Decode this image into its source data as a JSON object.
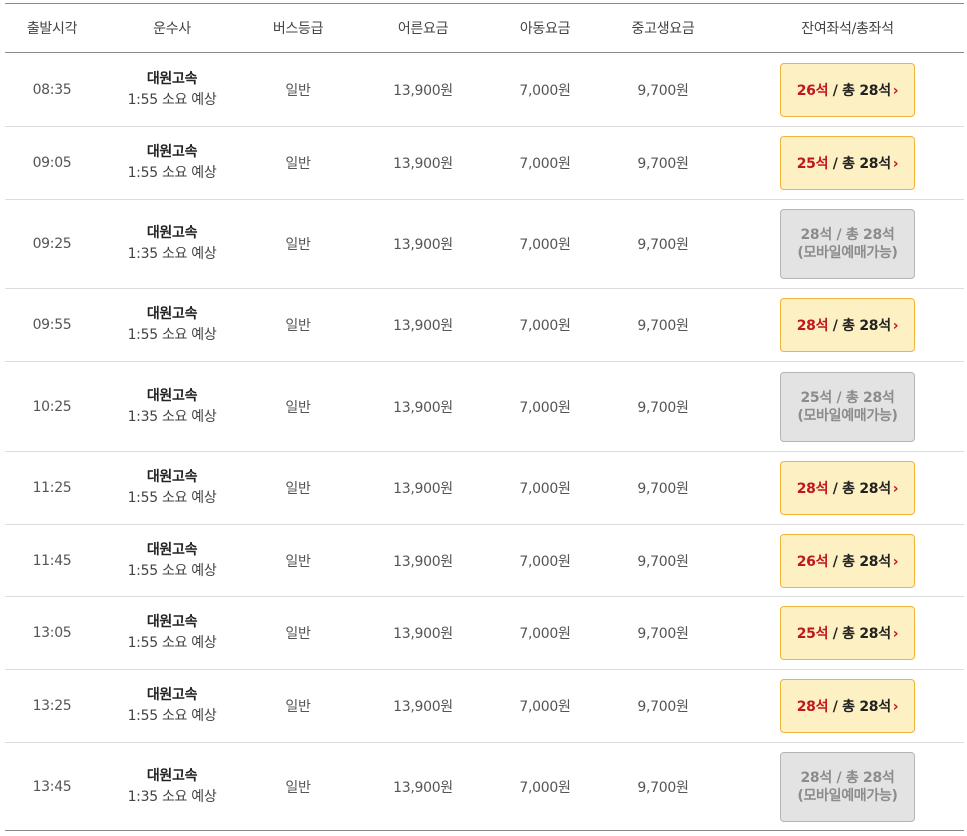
{
  "header": {
    "departure_time": "출발시각",
    "company": "운수사",
    "bus_grade": "버스등급",
    "adult_fare": "어른요금",
    "child_fare": "아동요금",
    "student_fare": "중고생요금",
    "seats": "잔여좌석/총좌석"
  },
  "rows": [
    {
      "time": "08:35",
      "company": "대원고속",
      "duration": "1:55 소요 예상",
      "grade": "일반",
      "adult": "13,900원",
      "child": "7,000원",
      "student": "9,700원",
      "remaining": "26석",
      "total": " / 총 28석",
      "arrow": "›",
      "mobile_note": "",
      "seat_status": "available"
    },
    {
      "time": "09:05",
      "company": "대원고속",
      "duration": "1:55 소요 예상",
      "grade": "일반",
      "adult": "13,900원",
      "child": "7,000원",
      "student": "9,700원",
      "remaining": "25석",
      "total": " / 총 28석",
      "arrow": "›",
      "mobile_note": "",
      "seat_status": "available"
    },
    {
      "time": "09:25",
      "company": "대원고속",
      "duration": "1:35 소요 예상",
      "grade": "일반",
      "adult": "13,900원",
      "child": "7,000원",
      "student": "9,700원",
      "remaining": "28석",
      "total": " / 총 28석",
      "arrow": "",
      "mobile_note": "(모바일예매가능)",
      "seat_status": "mobile"
    },
    {
      "time": "09:55",
      "company": "대원고속",
      "duration": "1:55 소요 예상",
      "grade": "일반",
      "adult": "13,900원",
      "child": "7,000원",
      "student": "9,700원",
      "remaining": "28석",
      "total": " / 총 28석",
      "arrow": "›",
      "mobile_note": "",
      "seat_status": "available"
    },
    {
      "time": "10:25",
      "company": "대원고속",
      "duration": "1:35 소요 예상",
      "grade": "일반",
      "adult": "13,900원",
      "child": "7,000원",
      "student": "9,700원",
      "remaining": "25석",
      "total": " / 총 28석",
      "arrow": "",
      "mobile_note": "(모바일예매가능)",
      "seat_status": "mobile"
    },
    {
      "time": "11:25",
      "company": "대원고속",
      "duration": "1:55 소요 예상",
      "grade": "일반",
      "adult": "13,900원",
      "child": "7,000원",
      "student": "9,700원",
      "remaining": "28석",
      "total": " / 총 28석",
      "arrow": "›",
      "mobile_note": "",
      "seat_status": "available"
    },
    {
      "time": "11:45",
      "company": "대원고속",
      "duration": "1:55 소요 예상",
      "grade": "일반",
      "adult": "13,900원",
      "child": "7,000원",
      "student": "9,700원",
      "remaining": "26석",
      "total": " / 총 28석",
      "arrow": "›",
      "mobile_note": "",
      "seat_status": "available"
    },
    {
      "time": "13:05",
      "company": "대원고속",
      "duration": "1:55 소요 예상",
      "grade": "일반",
      "adult": "13,900원",
      "child": "7,000원",
      "student": "9,700원",
      "remaining": "25석",
      "total": " / 총 28석",
      "arrow": "›",
      "mobile_note": "",
      "seat_status": "available"
    },
    {
      "time": "13:25",
      "company": "대원고속",
      "duration": "1:55 소요 예상",
      "grade": "일반",
      "adult": "13,900원",
      "child": "7,000원",
      "student": "9,700원",
      "remaining": "28석",
      "total": " / 총 28석",
      "arrow": "›",
      "mobile_note": "",
      "seat_status": "available"
    },
    {
      "time": "13:45",
      "company": "대원고속",
      "duration": "1:35 소요 예상",
      "grade": "일반",
      "adult": "13,900원",
      "child": "7,000원",
      "student": "9,700원",
      "remaining": "28석",
      "total": " / 총 28석",
      "arrow": "",
      "mobile_note": "(모바일예매가능)",
      "seat_status": "mobile"
    }
  ],
  "colors": {
    "available_bg": "#fdf0c2",
    "available_border": "#f0b43c",
    "remaining_text": "#c0161e",
    "mobile_bg": "#e3e3e3",
    "mobile_border": "#b5b5b5",
    "mobile_text": "#8c8c8c"
  }
}
